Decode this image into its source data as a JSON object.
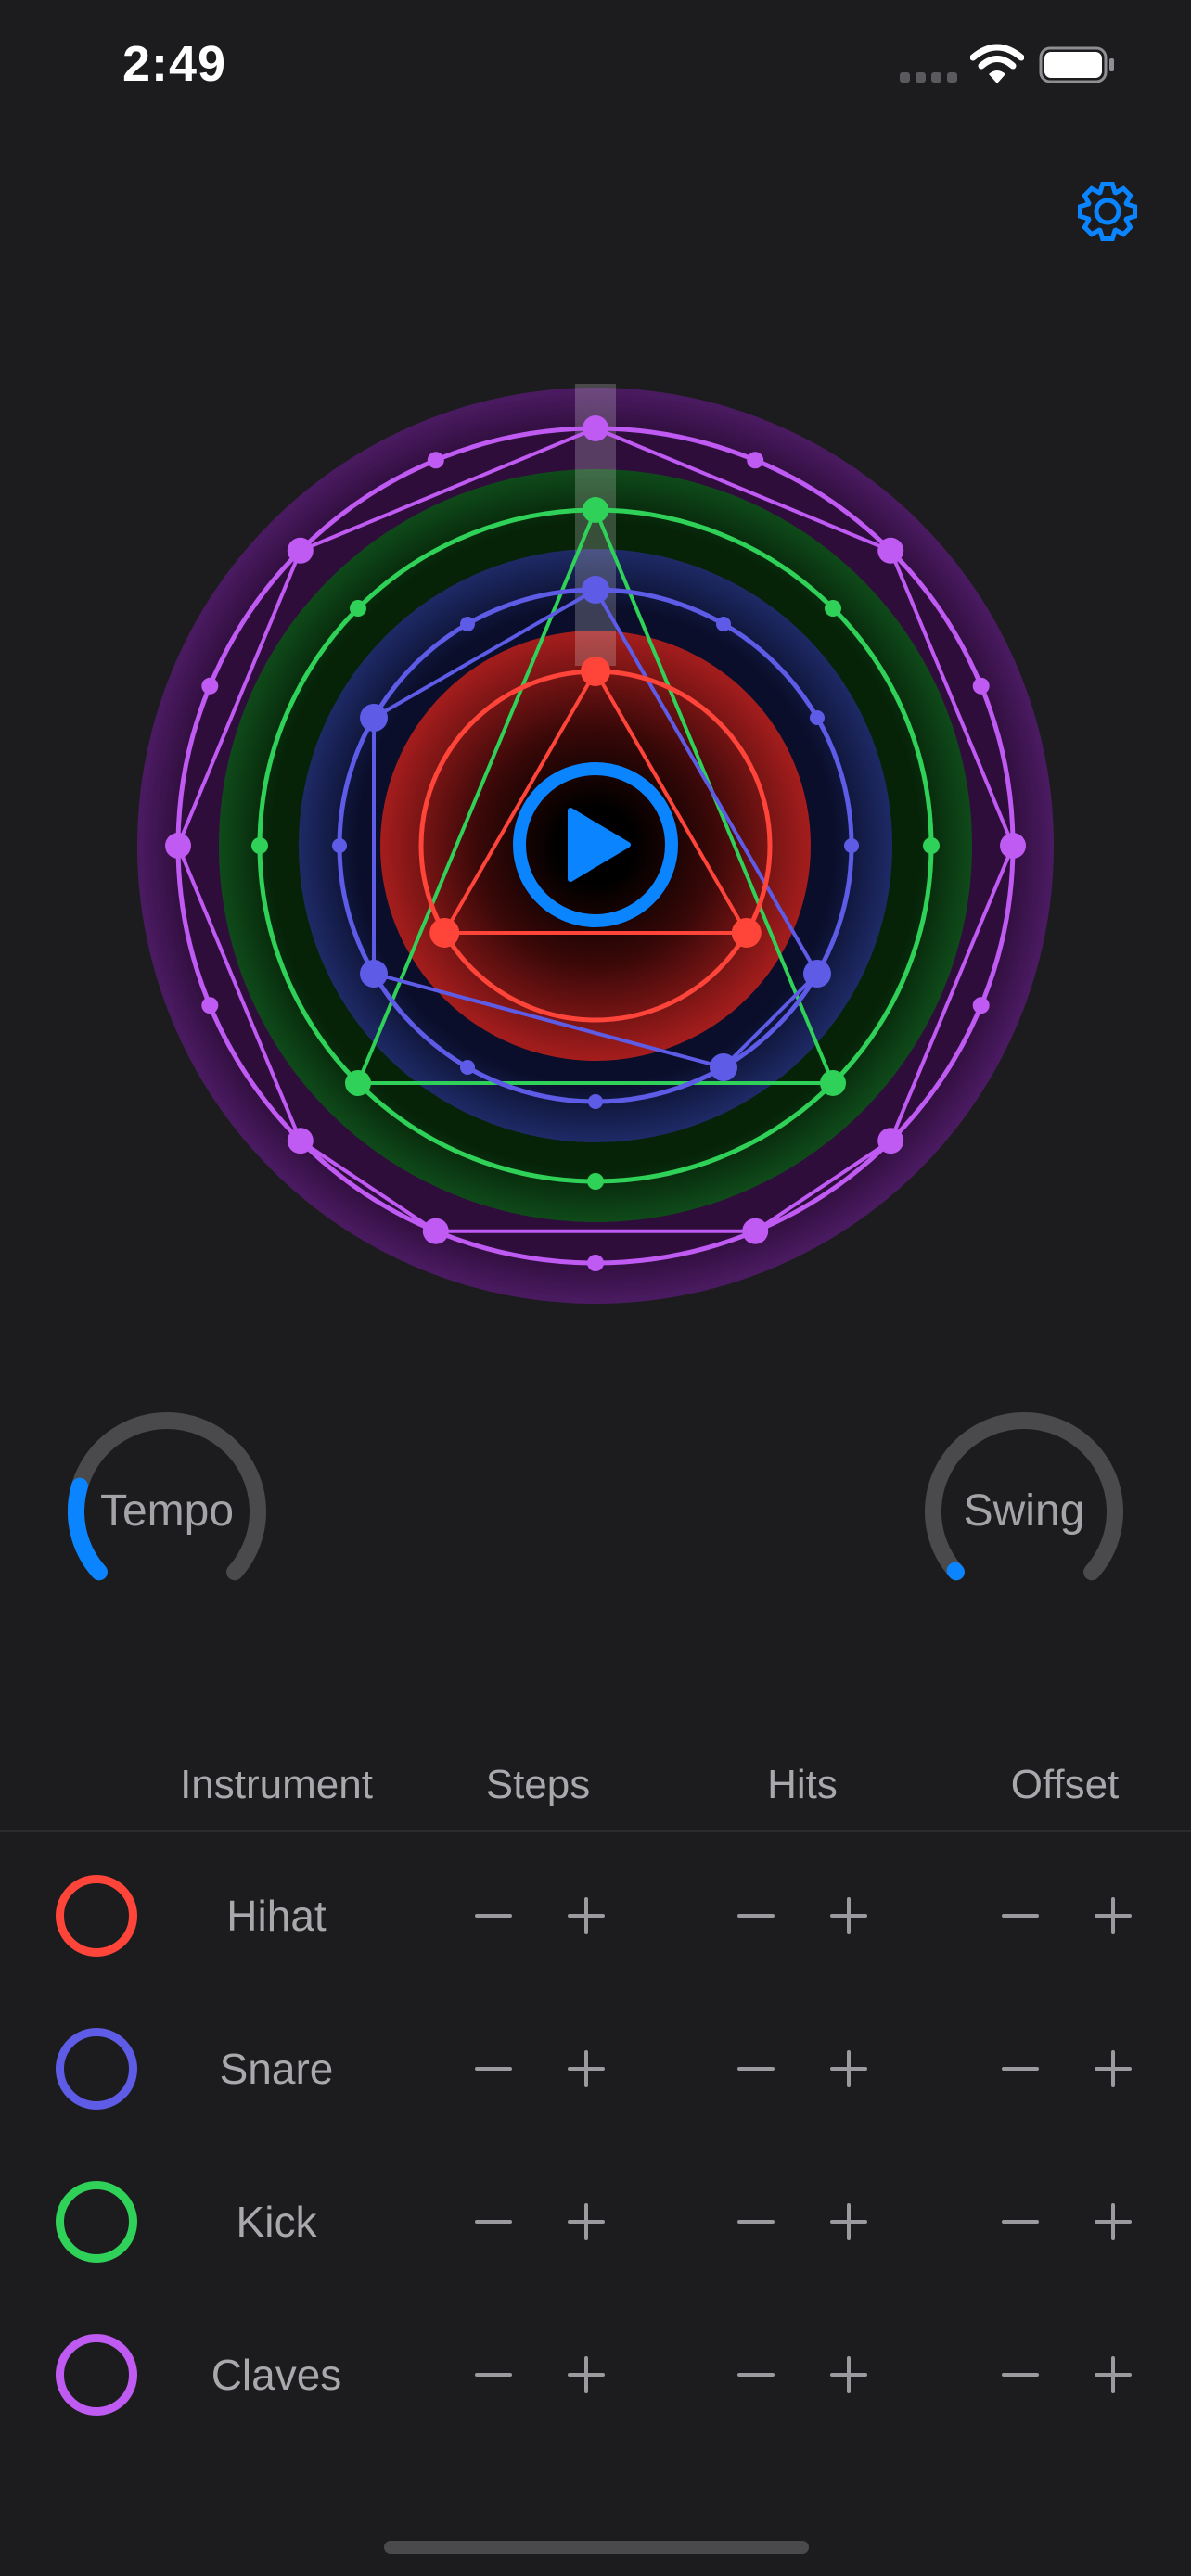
{
  "status_bar": {
    "time": "2:49",
    "battery_level": 1.0
  },
  "colors": {
    "accent": "#0a84ff",
    "hihat": "#ff453a",
    "snare": "#5e5ce6",
    "kick": "#30d158",
    "claves": "#bf5af2",
    "background": "#1c1c1e"
  },
  "icons": {
    "settings": "gear-icon",
    "play": "play-icon",
    "minus": "minus-icon",
    "plus": "plus-icon"
  },
  "controls": {
    "tempo": {
      "label": "Tempo",
      "value": 0.22
    },
    "swing": {
      "label": "Swing",
      "value": 0.0
    }
  },
  "table": {
    "headers": [
      "Instrument",
      "Steps",
      "Hits",
      "Offset"
    ],
    "rows": [
      {
        "name": "Hihat",
        "color": "#ff453a",
        "steps": 3,
        "hits": 3
      },
      {
        "name": "Snare",
        "color": "#5e5ce6",
        "steps": 12,
        "hits": 5
      },
      {
        "name": "Kick",
        "color": "#30d158",
        "steps": 8,
        "hits": 3
      },
      {
        "name": "Claves",
        "color": "#bf5af2",
        "steps": 16,
        "hits": 10
      }
    ]
  }
}
